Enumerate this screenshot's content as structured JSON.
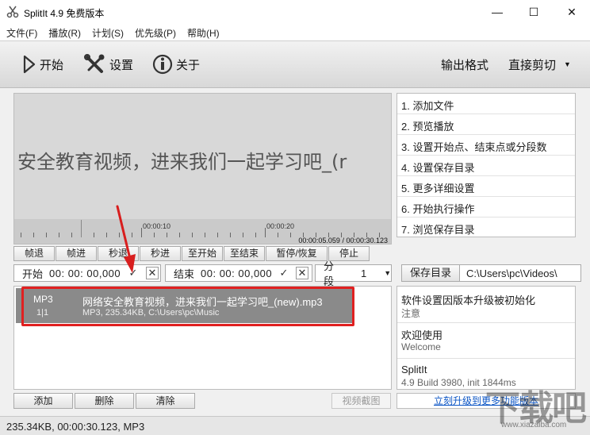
{
  "window": {
    "title": "SplitIt 4.9 免费版本",
    "minimize": "—",
    "maximize": "☐",
    "close": "✕"
  },
  "menu": [
    "文件(F)",
    "播放(R)",
    "计划(S)",
    "优先级(P)",
    "帮助(H)"
  ],
  "toolbar": {
    "start": "开始",
    "settings": "设置",
    "about": "关于",
    "output_format": "输出格式",
    "mode": "直接剪切"
  },
  "preview": {
    "title_text": "安全教育视频，进来我们一起学习吧_(r",
    "timeline_labels": [
      "00:00:10",
      "00:00:20"
    ],
    "time_readout": "00:00:05.059 / 00:00:30.123"
  },
  "controls": [
    "帧退",
    "帧进",
    "秒退",
    "秒进",
    "至开始",
    "至结束",
    "暂停/恢复",
    "停止"
  ],
  "range": {
    "start_label": "开始",
    "start_value": "00: 00: 00,000",
    "end_label": "结束",
    "end_value": "00: 00: 00,000",
    "split_label": "分段",
    "split_value": "1"
  },
  "save": {
    "button": "保存目录",
    "path": "C:\\Users\\pc\\Videos\\"
  },
  "file": {
    "type": "MP3",
    "count": "1|1",
    "name": "网络安全教育视频，进来我们一起学习吧_(new).mp3",
    "info": "MP3, 235.34KB, C:\\Users\\pc\\Music"
  },
  "steps": [
    "1. 添加文件",
    "2. 预览播放",
    "3. 设置开始点、结束点或分段数",
    "4. 设置保存目录",
    "5. 更多详细设置",
    "6. 开始执行操作",
    "7. 浏览保存目录"
  ],
  "info_panel": [
    {
      "title": "软件设置因版本升级被初始化",
      "sub": "注意"
    },
    {
      "title": "欢迎使用",
      "sub": "Welcome"
    },
    {
      "title": "SplitIt",
      "sub": "4.9 Build 3980, init 1844ms"
    }
  ],
  "bottom": {
    "add": "添加",
    "delete": "删除",
    "clear": "清除",
    "snapshot": "视频截图",
    "upgrade": "立刻升级到更多功能版本"
  },
  "status": "235.34KB, 00:00:30.123, MP3",
  "watermark": {
    "main": "下载吧",
    "sub": "www.xiazaiba.com"
  },
  "colors": {
    "highlight": "#e02020",
    "selected_row": "#8a8a8a",
    "link": "#0b55c5"
  }
}
